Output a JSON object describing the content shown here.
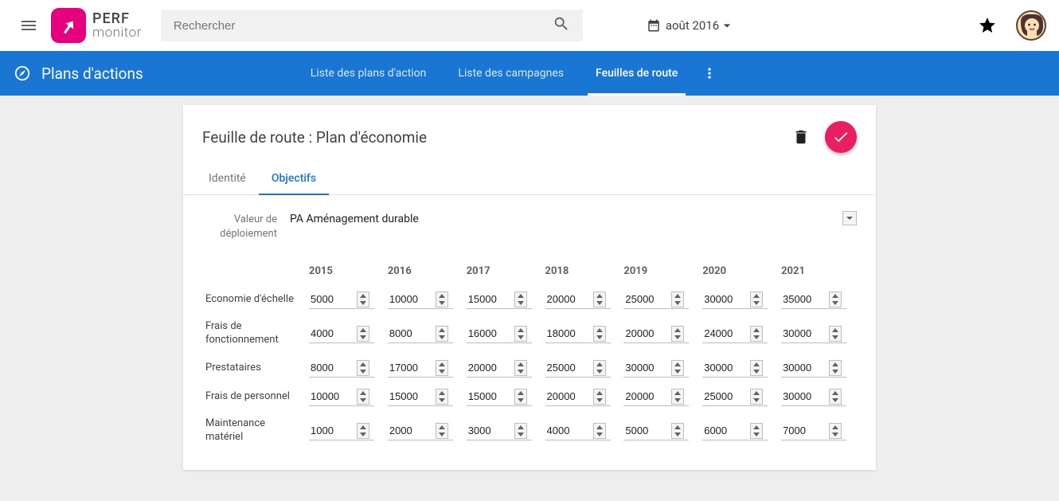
{
  "brand": {
    "line1": "PERF",
    "line2": "monitor"
  },
  "search": {
    "placeholder": "Rechercher"
  },
  "date": {
    "label": "août 2016"
  },
  "navbar": {
    "title": "Plans d'actions",
    "tabs": [
      "Liste des plans d'action",
      "Liste des campagnes",
      "Feuilles de route"
    ]
  },
  "card": {
    "title": "Feuille de route : Plan d'économie",
    "subtabs": [
      "Identité",
      "Objectifs"
    ],
    "deploy_label_1": "Valeur de",
    "deploy_label_2": "déploiement",
    "deploy_value": "PA Aménagement durable"
  },
  "years": [
    "2015",
    "2016",
    "2017",
    "2018",
    "2019",
    "2020",
    "2021"
  ],
  "rows": [
    {
      "label": "Economie d'échelle",
      "values": [
        "5000",
        "10000",
        "15000",
        "20000",
        "25000",
        "30000",
        "35000"
      ]
    },
    {
      "label": "Frais de fonctionnement",
      "values": [
        "4000",
        "8000",
        "16000",
        "18000",
        "20000",
        "24000",
        "30000"
      ]
    },
    {
      "label": "Prestataires",
      "values": [
        "8000",
        "17000",
        "20000",
        "25000",
        "30000",
        "30000",
        "30000"
      ]
    },
    {
      "label": "Frais de personnel",
      "values": [
        "10000",
        "15000",
        "15000",
        "20000",
        "20000",
        "25000",
        "30000"
      ]
    },
    {
      "label": "Maintenance matériel",
      "values": [
        "1000",
        "2000",
        "3000",
        "4000",
        "5000",
        "6000",
        "7000"
      ]
    }
  ]
}
